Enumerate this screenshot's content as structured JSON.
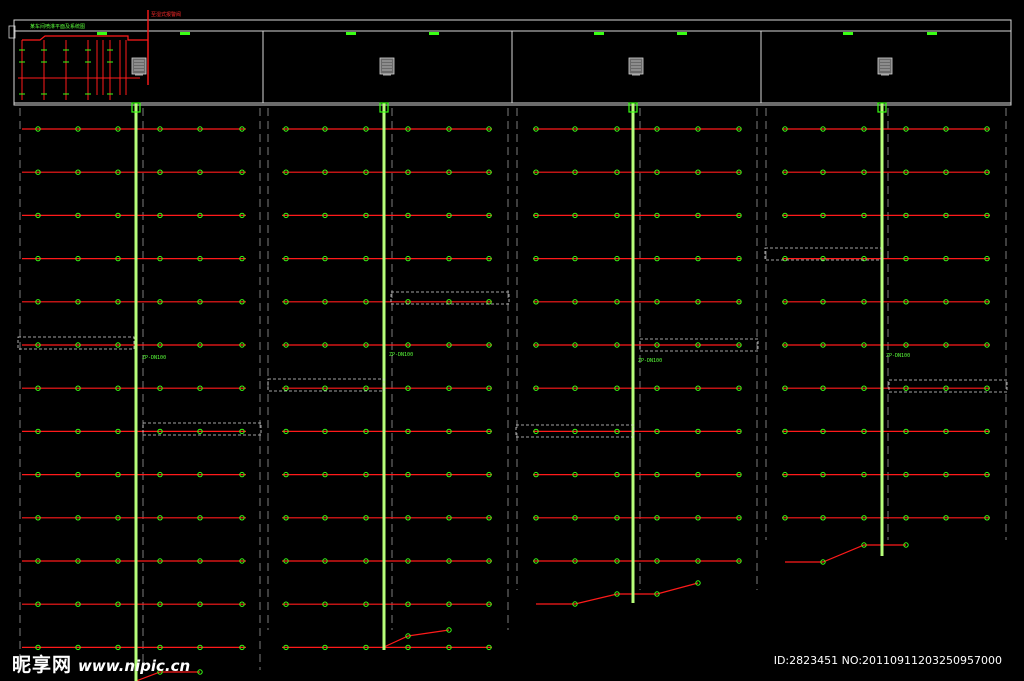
{
  "drawing": {
    "title_label": "某车间喷淋平面及系统图",
    "riser_tag": "至湿式报警阀",
    "zone_labels": [
      "ZP-DN100",
      "ZP-DN100",
      "ZP-DN100",
      "ZP-DN100"
    ],
    "colors": {
      "background": "#000000",
      "sprinkler_pipe": "#ff1a1a",
      "sprinkler_head": "#39ff14",
      "main_pipe": "#b7ff7a",
      "outline": "#d8d8d8",
      "dashed": "#9a9a9a"
    }
  },
  "watermark": {
    "brand": "昵享网",
    "url": "www.nipic.cn",
    "id_text": "ID:2823451 NO:20110911203250957000"
  }
}
